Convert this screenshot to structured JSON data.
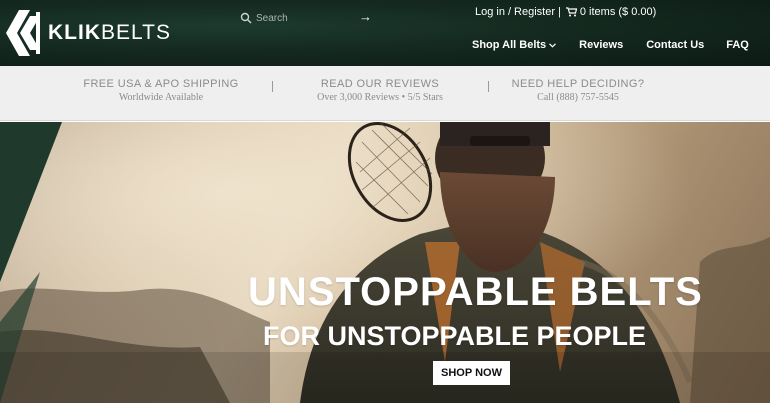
{
  "brand": {
    "name_bold": "KLIK",
    "name_light": "BELTS"
  },
  "search": {
    "placeholder": "Search",
    "go_icon": "arrow-right-icon"
  },
  "account": {
    "login_label": "Log in",
    "separator": "/",
    "register_label": "Register",
    "divider": "|",
    "cart_label": "0 items ($ 0.00)"
  },
  "nav": {
    "items": [
      {
        "label": "Shop All Belts",
        "has_dropdown": true
      },
      {
        "label": "Reviews"
      },
      {
        "label": "Contact Us"
      },
      {
        "label": "FAQ"
      }
    ]
  },
  "info_bar": {
    "items": [
      {
        "title": "FREE USA & APO SHIPPING",
        "subtitle": "Worldwide Available"
      },
      {
        "title": "READ OUR REVIEWS",
        "subtitle": "Over 3,000 Reviews • 5/5 Stars"
      },
      {
        "title": "NEED HELP DECIDING?",
        "subtitle": "Call (888) 757-5545"
      }
    ],
    "divider": "|"
  },
  "hero": {
    "title": "UNSTOPPABLE BELTS",
    "subtitle": "FOR UNSTOPPABLE PEOPLE",
    "cta_label": "SHOP NOW"
  },
  "colors": {
    "header_bg": "#14291f",
    "info_bar_bg": "#efefef",
    "info_text": "#8b8b8b",
    "hero_text": "#ffffff",
    "cta_bg": "#ffffff"
  }
}
